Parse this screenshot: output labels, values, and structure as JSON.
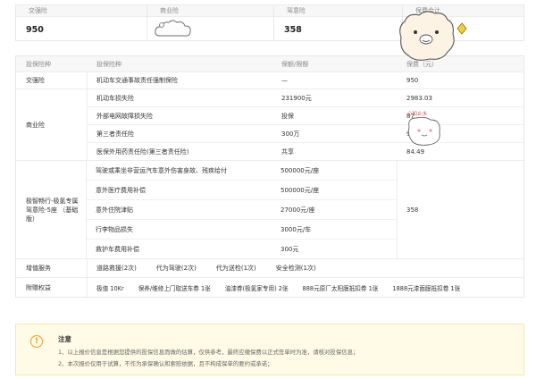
{
  "summary": {
    "cols": [
      {
        "head": "交强险",
        "value": "950"
      },
      {
        "head": "商业险",
        "value": ""
      },
      {
        "head": "驾意险",
        "value": "358"
      },
      {
        "head": "保费合计",
        "value": ""
      }
    ]
  },
  "table": {
    "headers": [
      "投保险种",
      "投保险种",
      "保额/限额",
      "保费（元）"
    ],
    "jqx": {
      "type": "交强险",
      "name": "机动车交通事故责任强制保险",
      "limit": "—",
      "premium": "950"
    },
    "syx": {
      "type": "商业险",
      "rows": [
        {
          "name": "机动车损失险",
          "limit": "231900元",
          "premium": "2983.03"
        },
        {
          "name": "外部电网故障损失险",
          "limit": "投保",
          "premium": "87"
        },
        {
          "name": "第三者责任险",
          "limit": "300万",
          "premium": "9"
        },
        {
          "name": "医保外用药责任险(第三者责任险)",
          "limit": "共享",
          "premium": "84.49"
        }
      ]
    },
    "jyx": {
      "type_line1": "极智畅行-极氪专属",
      "type_line2": "驾意险-5座 （基础",
      "type_line3": "版）",
      "premium": "358",
      "rows": [
        {
          "name": "驾驶或乘坐非营运汽车意外伤害身故、残疾给付",
          "limit": "500000元/座"
        },
        {
          "name": "意外医疗费用补偿",
          "limit": "500000元/座"
        },
        {
          "name": "意外住院津贴",
          "limit": "27000元/座"
        },
        {
          "name": "行李物品损失",
          "limit": "3000元/车"
        },
        {
          "name": "救护车费用补偿",
          "limit": "300元"
        }
      ]
    },
    "service": {
      "label": "增值服务",
      "items": [
        "道路救援(2次)",
        "代为驾驶(2次)",
        "代为送检(1次)",
        "安全检测(1次)"
      ]
    },
    "benefits": {
      "label": "附赠权益",
      "items": [
        "极值 10Kr",
        "保养/维修上门取送车券 1张",
        "油漆券(极氪家专用) 2张",
        "888元原厂太阳膜抵扣券 1张",
        "1888元漆面膜抵扣卷 1张"
      ]
    }
  },
  "notice": {
    "title": "注意",
    "line1": "1、以上报价信息是根据您提供的投保信息而做的估算，仅供参考，最终应缴保费以正式签单时为准，请核对投保信息；",
    "line2": "2、本次报价仅用于试算，不作为承保确认和索赔依据，且不构成保单的要约或承诺；"
  },
  "stickers": {
    "sticker_caption": "心如止水"
  },
  "colors": {
    "notice_bg": "#fffbe6",
    "notice_icon": "#f0a020",
    "header_bg": "#f7f7f7"
  }
}
